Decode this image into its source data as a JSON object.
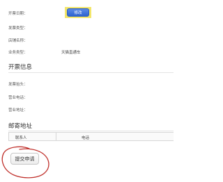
{
  "invoice_basic": {
    "fields": [
      {
        "label": "开票日期：",
        "value": ""
      },
      {
        "label": "发票类型：",
        "value": ""
      },
      {
        "label": "店铺名称：",
        "value": ""
      },
      {
        "label": "业务类型：",
        "value": "天猫直通车"
      }
    ],
    "modify_button": "修改"
  },
  "invoice_info": {
    "title": "开票信息",
    "fields": [
      {
        "label": "发票抬头：",
        "value": ""
      },
      {
        "label": "营业电话：",
        "value": ""
      },
      {
        "label": "营业地址：",
        "value": ""
      }
    ]
  },
  "mailing": {
    "title": "邮寄地址",
    "columns": [
      "联系人",
      "电话"
    ]
  },
  "submit_button": "提交申请",
  "colors": {
    "modify_highlight": "#f3e66a",
    "modify_button": "#2f64cf",
    "annotation_circle": "#c0302b"
  }
}
